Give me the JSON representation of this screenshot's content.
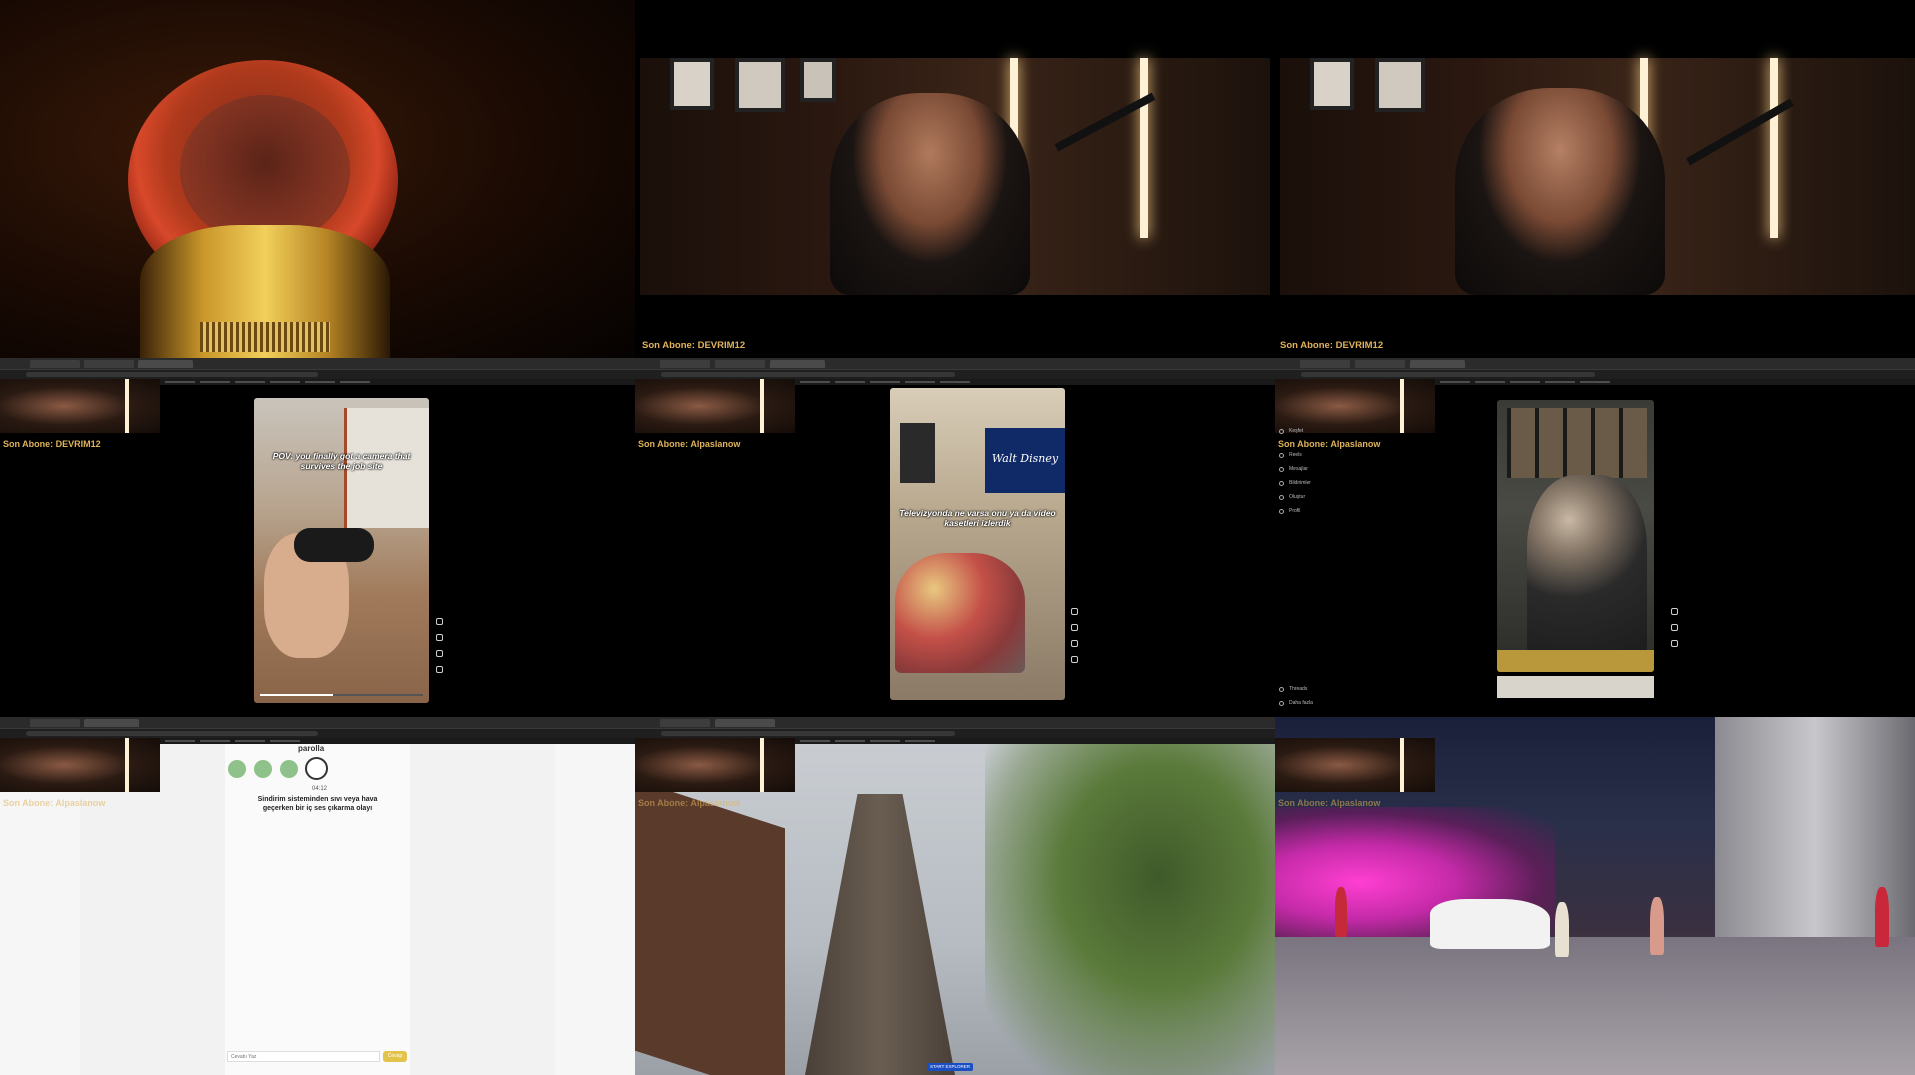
{
  "subscriber_labels": {
    "tile2": "Son Abone: DEVRIM12",
    "tile3": "Son Abone: DEVRIM12",
    "tile4": "Son Abone: DEVRIM12",
    "tile5": "Son Abone: Alpaslanow",
    "tile6": "Son Abone: Alpaslanow",
    "tile7": "Son Abone: Alpaslanow",
    "tile8": "Son Abone: Alpaslanow",
    "tile9": "Son Abone: Alpaslanow"
  },
  "reel1": {
    "caption": "POV: you finally got a camera that survives the job site"
  },
  "reel2": {
    "caption": "Televizyonda ne varsa onu ya da video kasetleri izlerdik",
    "brand": "Walt Disney"
  },
  "sidebar_tile6": {
    "items": [
      "Keşfet",
      "Reels",
      "Mesajlar",
      "Bildirimler",
      "Oluştur",
      "Profil"
    ],
    "bottom_items": [
      "Threads",
      "Daha fazla"
    ]
  },
  "word_game": {
    "title": "parolla",
    "timer": "04:12",
    "question": "Sindirim sisteminden sıvı veya hava geçerken bir iç ses çıkarma olayı",
    "input_placeholder": "Cevabı Yaz",
    "submit_label": "Cevap"
  },
  "street_view": {
    "button_label": "START EXPLORER"
  },
  "colors": {
    "label_gold": "#e0b25a",
    "neon_pink": "#ff3fd2",
    "game_green": "#8ec28a",
    "submit_yellow": "#e4c34a"
  }
}
